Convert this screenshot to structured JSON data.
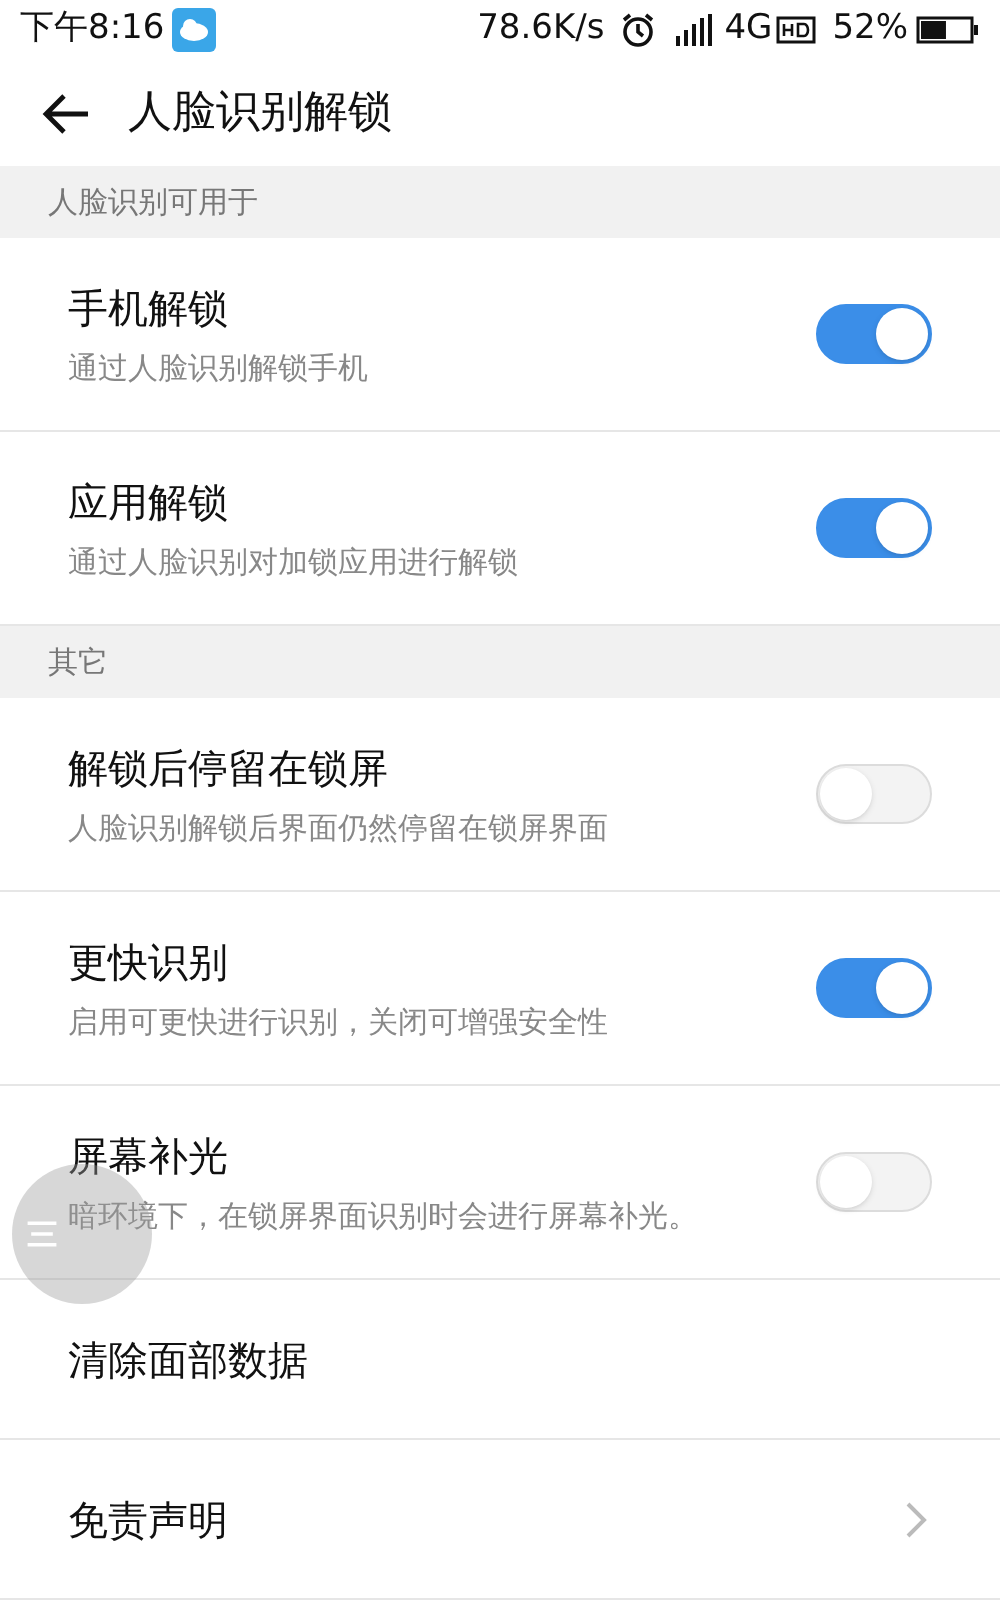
{
  "status_bar": {
    "time": "下午8:16",
    "speed": "78.6K/s",
    "network": "4G",
    "battery": "52%",
    "battery_meter": {
      "level": 0.52
    }
  },
  "header": {
    "title": "人脸识别解锁"
  },
  "sections": [
    {
      "title": "人脸识别可用于",
      "items": [
        {
          "kind": "toggle",
          "title": "手机解锁",
          "subtitle": "通过人脸识别解锁手机",
          "on": true
        },
        {
          "kind": "toggle",
          "title": "应用解锁",
          "subtitle": "通过人脸识别对加锁应用进行解锁",
          "on": true
        }
      ]
    },
    {
      "title": "其它",
      "items": [
        {
          "kind": "toggle",
          "title": "解锁后停留在锁屏",
          "subtitle": "人脸识别解锁后界面仍然停留在锁屏界面",
          "on": false
        },
        {
          "kind": "toggle",
          "title": "更快识别",
          "subtitle": "启用可更快进行识别，关闭可增强安全性",
          "on": true
        },
        {
          "kind": "toggle",
          "title": "屏幕补光",
          "subtitle": "暗环境下，在锁屏界面识别时会进行屏幕补光。",
          "on": false
        },
        {
          "kind": "plain",
          "title": "清除面部数据"
        },
        {
          "kind": "link",
          "title": "免责声明"
        }
      ]
    }
  ]
}
